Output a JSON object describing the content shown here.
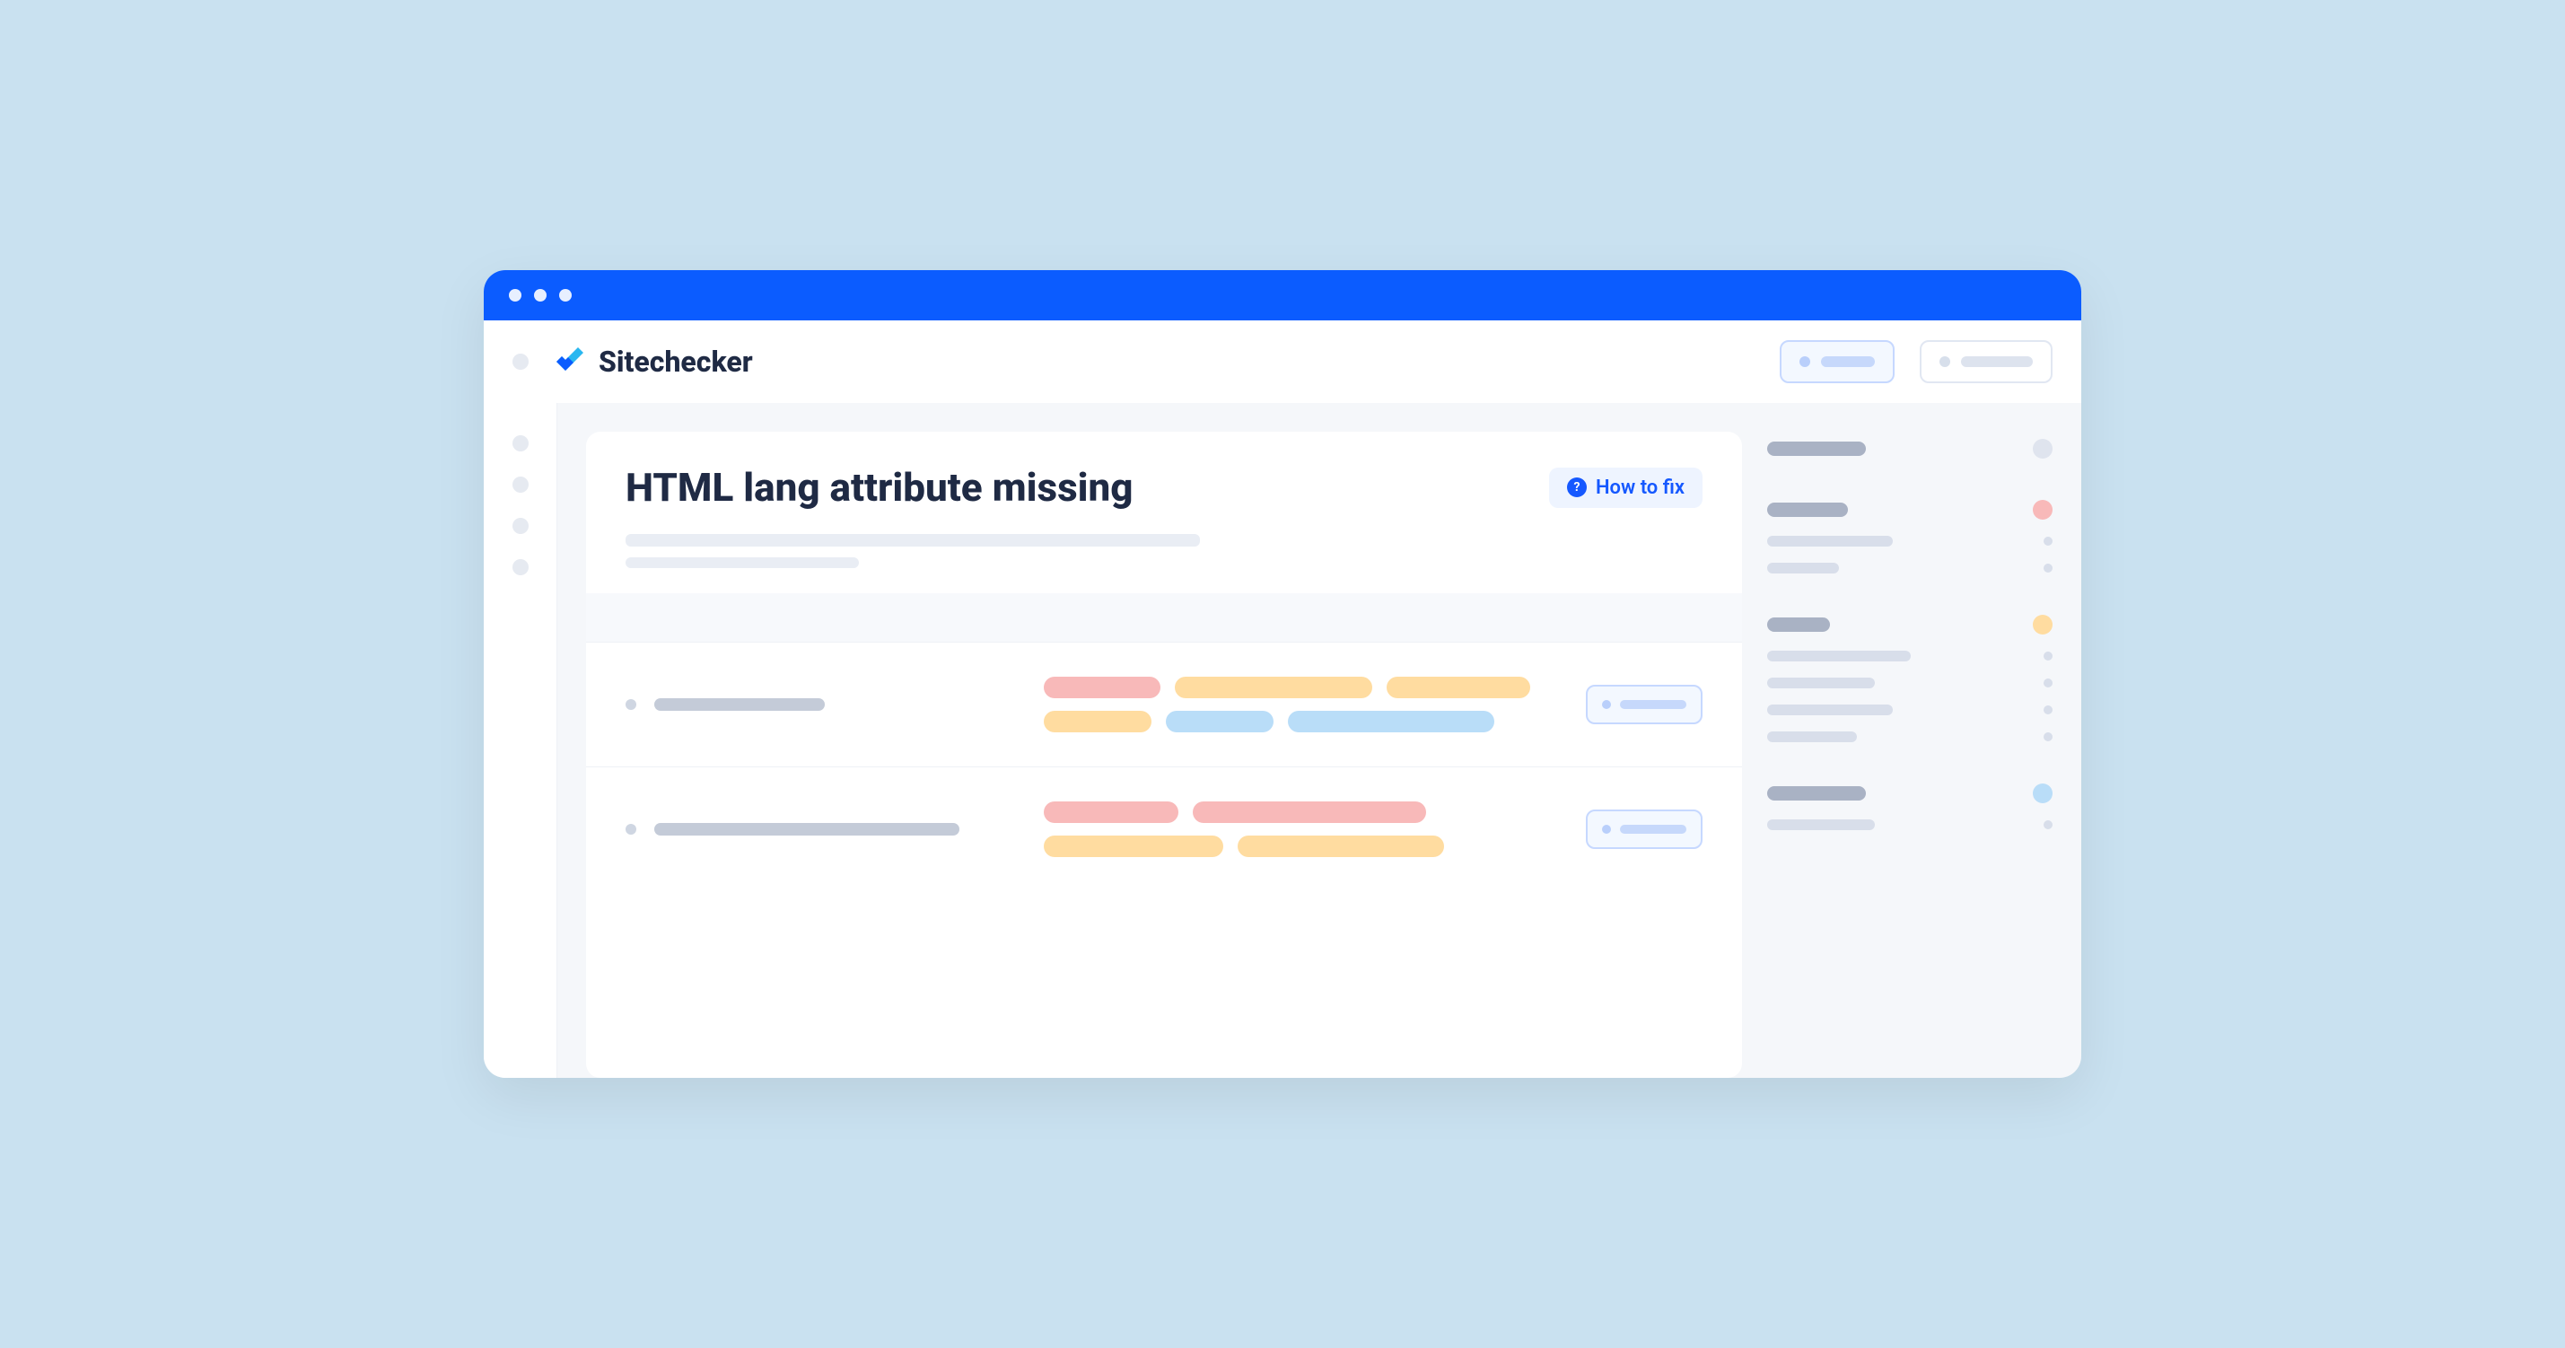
{
  "brand": {
    "name": "Sitechecker"
  },
  "page": {
    "title": "HTML lang attribute missing",
    "how_to_fix_label": "How to fix"
  }
}
